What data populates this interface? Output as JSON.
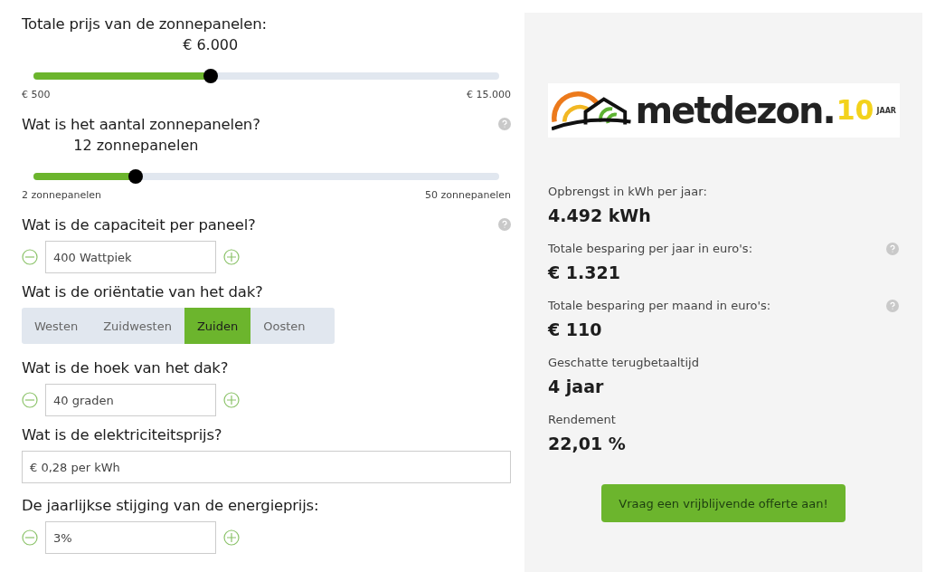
{
  "questions": [
    {
      "kind": "slider",
      "label": "Totale prijs van de zonnepanelen:",
      "help": false,
      "value": "€ 6.000",
      "level": 0.38,
      "min": "€ 500",
      "max": "€ 15.000"
    },
    {
      "kind": "slider",
      "label": "Wat is het aantal zonnepanelen?",
      "help": true,
      "value": "12 zonnepanelen",
      "level": 0.22,
      "min": "2 zonnepanelen",
      "max": "50 zonnepanelen"
    },
    {
      "kind": "stepper",
      "label": "Wat is de capaciteit per paneel?",
      "help": true,
      "value": "400 Wattpiek"
    },
    {
      "kind": "choice",
      "label": "Wat is de oriëntatie van het dak?",
      "help": false,
      "options": [
        {
          "label": "Westen",
          "selected": false
        },
        {
          "label": "Zuidwesten",
          "selected": false
        },
        {
          "label": "Zuiden",
          "selected": true
        },
        {
          "label": "Oosten",
          "selected": false
        }
      ]
    },
    {
      "kind": "stepper",
      "label": "Wat is de hoek van het dak?",
      "help": false,
      "value": "40 graden"
    },
    {
      "kind": "text",
      "label": "Wat is de elektriciteitsprijs?",
      "help": false,
      "value": "€ 0,28 per kWh"
    },
    {
      "kind": "stepper",
      "label": "De jaarlijkse stijging van de energieprijs:",
      "help": false,
      "value": "3%"
    }
  ],
  "logo": {
    "wordmark": "metdezon",
    "dot": ".",
    "anniversary": "10",
    "anniversary_unit": "JAAR"
  },
  "results": [
    {
      "label": "Opbrengst in kWh per jaar:",
      "value": "4.492 kWh",
      "help": false
    },
    {
      "label": "Totale besparing per jaar in euro's:",
      "value": "€ 1.321",
      "help": true
    },
    {
      "label": "Totale besparing per maand in euro's:",
      "value": "€ 110",
      "help": true
    },
    {
      "label": "Geschatte terugbetaaltijd",
      "value": "4 jaar",
      "help": false
    },
    {
      "label": "Rendement",
      "value": "22,01 %",
      "help": false
    }
  ],
  "cta": "Vraag een vrijblijvende offerte aan!"
}
